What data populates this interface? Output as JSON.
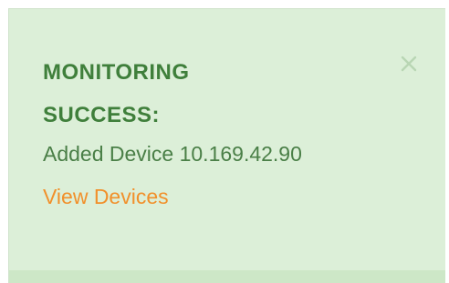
{
  "notification": {
    "title_line1": "MONITORING",
    "title_line2": "SUCCESS:",
    "message": "Added Device 10.169.42.90",
    "link_label": "View Devices",
    "close_icon": "close-icon",
    "colors": {
      "background": "#dcefd8",
      "title": "#3f7f3b",
      "message": "#4a7f47",
      "link": "#f1902b",
      "close": "#b9d6b4"
    }
  }
}
